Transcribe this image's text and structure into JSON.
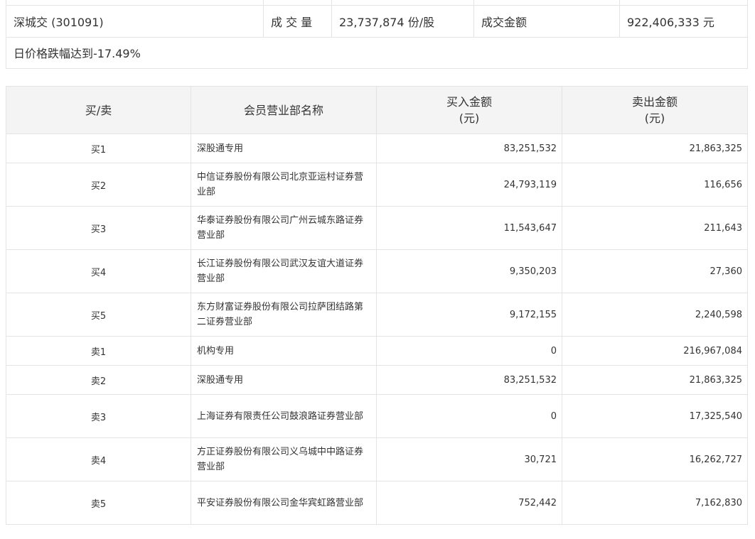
{
  "summary": {
    "stock": "深城交 (301091)",
    "volume_label": "成 交 量",
    "volume_value": "23,737,874 份/股",
    "amount_label": "成交金额",
    "amount_value": "922,406,333 元",
    "note": "日价格跌幅达到-17.49%"
  },
  "table": {
    "headers": {
      "side": "买/卖",
      "name": "会员营业部名称",
      "buy_line1": "买入金额",
      "buy_line2": "(元)",
      "sell_line1": "卖出金额",
      "sell_line2": "(元)"
    },
    "rows": [
      {
        "side": "买1",
        "name": "深股通专用",
        "buy": "83,251,532",
        "sell": "21,863,325"
      },
      {
        "side": "买2",
        "name": "中信证券股份有限公司北京亚运村证券营业部",
        "buy": "24,793,119",
        "sell": "116,656"
      },
      {
        "side": "买3",
        "name": "华泰证券股份有限公司广州云城东路证券营业部",
        "buy": "11,543,647",
        "sell": "211,643"
      },
      {
        "side": "买4",
        "name": "长江证券股份有限公司武汉友谊大道证券营业部",
        "buy": "9,350,203",
        "sell": "27,360"
      },
      {
        "side": "买5",
        "name": "东方财富证券股份有限公司拉萨团结路第二证券营业部",
        "buy": "9,172,155",
        "sell": "2,240,598"
      },
      {
        "side": "卖1",
        "name": "机构专用",
        "buy": "0",
        "sell": "216,967,084"
      },
      {
        "side": "卖2",
        "name": "深股通专用",
        "buy": "83,251,532",
        "sell": "21,863,325"
      },
      {
        "side": "卖3",
        "name": "上海证券有限责任公司鼓浪路证券营业部",
        "buy": "0",
        "sell": "17,325,540"
      },
      {
        "side": "卖4",
        "name": "方正证券股份有限公司义乌城中中路证券营业部",
        "buy": "30,721",
        "sell": "16,262,727"
      },
      {
        "side": "卖5",
        "name": "平安证券股份有限公司金华宾虹路营业部",
        "buy": "752,442",
        "sell": "7,162,830"
      }
    ]
  }
}
